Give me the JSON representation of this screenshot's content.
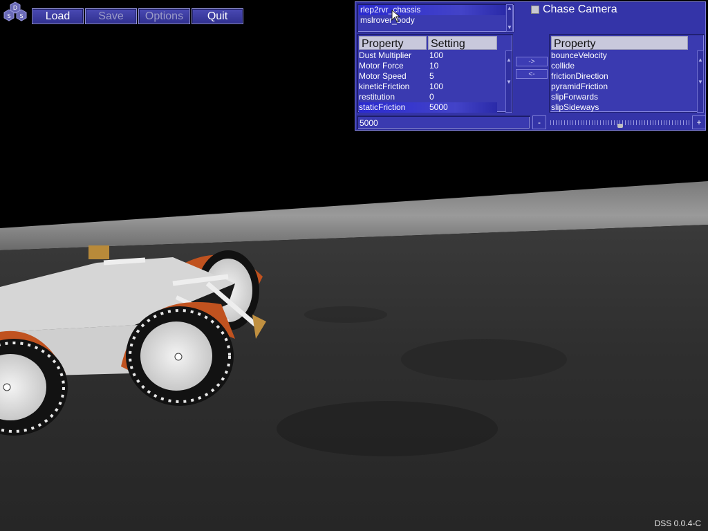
{
  "menu": {
    "load_label": "Load",
    "save_label": "Save",
    "options_label": "Options",
    "quit_label": "Quit"
  },
  "logo": {
    "letters": [
      "D",
      "S",
      "S"
    ]
  },
  "panel": {
    "objects": [
      "rlep2rvr_chassis",
      "mslrover_body"
    ],
    "chase_camera_label": "Chase Camera",
    "left_table": {
      "headers": [
        "Property",
        "Setting"
      ],
      "rows": [
        {
          "property": "Dust Multiplier",
          "setting": "100"
        },
        {
          "property": "Motor Force",
          "setting": "10"
        },
        {
          "property": "Motor Speed",
          "setting": "5"
        },
        {
          "property": "kineticFriction",
          "setting": "100"
        },
        {
          "property": "restitution",
          "setting": "0"
        },
        {
          "property": "staticFriction",
          "setting": "5000"
        }
      ]
    },
    "add_arrow_label": "->",
    "remove_arrow_label": "<-",
    "right_table": {
      "header": "Property",
      "rows": [
        "bounceVelocity",
        "collide",
        "frictionDirection",
        "pyramidFriction",
        "slipForwards",
        "slipSideways"
      ]
    },
    "value_field": "5000",
    "minus_label": "-",
    "plus_label": "+",
    "slider_fraction": 0.5
  },
  "version": "DSS 0.0.4-C",
  "colors": {
    "panel": "#3434a8",
    "selection": "#2b2bd0",
    "button": "#3a3aa0",
    "wheel_fender": "#c0521f"
  }
}
